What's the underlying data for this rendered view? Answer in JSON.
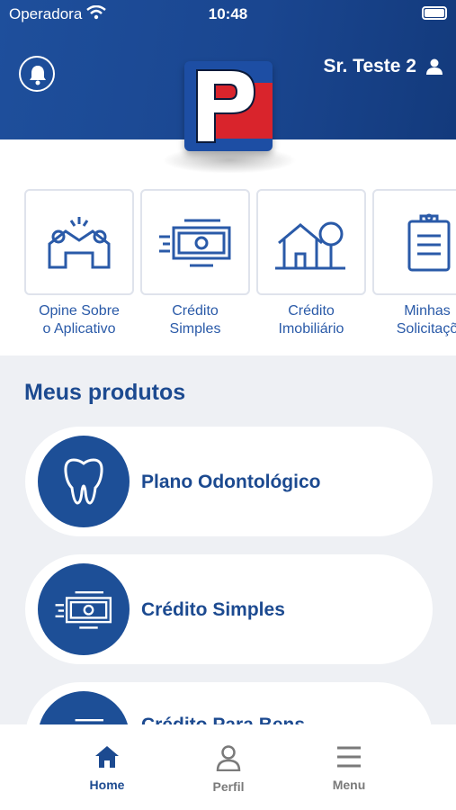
{
  "status_bar": {
    "carrier": "Operadora",
    "time": "10:48"
  },
  "header": {
    "user_name": "Sr. Teste 2"
  },
  "shortcuts": [
    {
      "label": "Opine Sobre\no Aplicativo",
      "icon": "hands-house-icon"
    },
    {
      "label": "Crédito\nSimples",
      "icon": "money-icon"
    },
    {
      "label": "Crédito\nImobiliário",
      "icon": "house-tree-icon"
    },
    {
      "label": "Minhas\nSolicitaçõ",
      "icon": "clipboard-icon"
    }
  ],
  "products_section": {
    "title": "Meus produtos",
    "items": [
      {
        "name": "Plano Odontológico",
        "icon": "tooth-icon"
      },
      {
        "name": "Crédito Simples",
        "icon": "money-icon"
      },
      {
        "name": "Crédito Para Bens",
        "icon": "money-icon"
      }
    ]
  },
  "tabbar": {
    "tabs": [
      {
        "label": "Home",
        "icon": "home-icon",
        "active": true
      },
      {
        "label": "Perfil",
        "icon": "person-icon",
        "active": false
      },
      {
        "label": "Menu",
        "icon": "hamburger-icon",
        "active": false
      }
    ]
  },
  "colors": {
    "primary": "#1c4a90",
    "accent_red": "#d9242c",
    "background": "#eef0f4"
  }
}
